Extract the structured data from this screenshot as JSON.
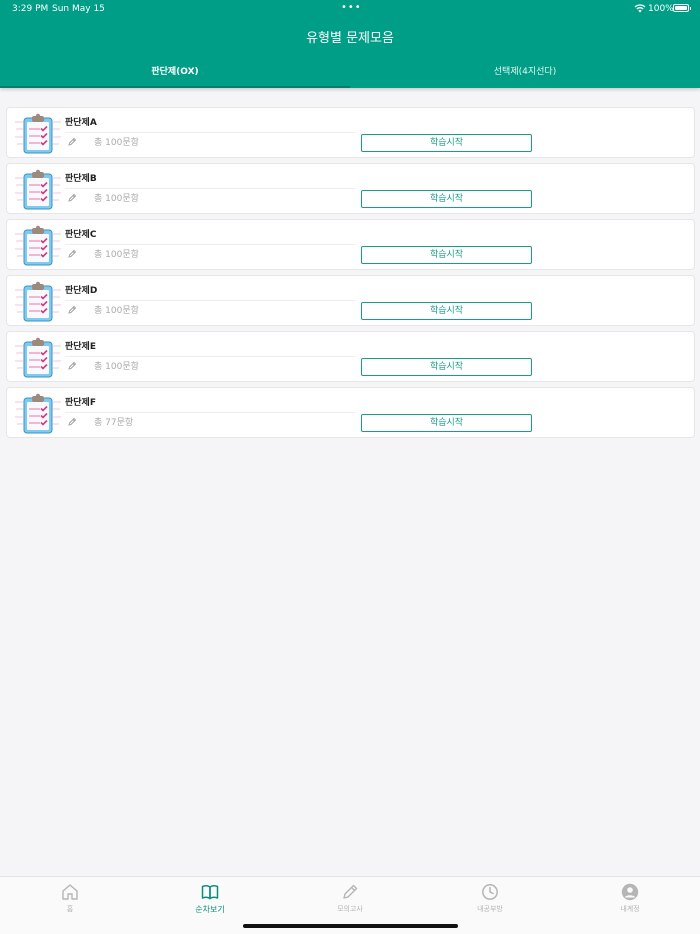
{
  "status_bar": {
    "time": "3:29 PM",
    "date": "Sun May 15",
    "dots": "•••",
    "battery_text": "100%"
  },
  "header": {
    "title": "유형별 문제모음"
  },
  "tabs": [
    {
      "label": "판단제(OX)",
      "active": true
    },
    {
      "label": "선택제(4지선다)",
      "active": false
    }
  ],
  "items": [
    {
      "name": "판단제A",
      "count": "총 100문항",
      "button": "학습시작"
    },
    {
      "name": "판단제B",
      "count": "총 100문항",
      "button": "학습시작"
    },
    {
      "name": "판단제C",
      "count": "총 100문항",
      "button": "학습시작"
    },
    {
      "name": "판단제D",
      "count": "총 100문항",
      "button": "학습시작"
    },
    {
      "name": "판단제E",
      "count": "총 100문항",
      "button": "학습시작"
    },
    {
      "name": "판단제F",
      "count": "총 77문항",
      "button": "학습시작"
    }
  ],
  "bottom_nav": [
    {
      "label": "홈",
      "icon": "home-icon",
      "active": false
    },
    {
      "label": "순차보기",
      "icon": "book-icon",
      "active": true
    },
    {
      "label": "모의고사",
      "icon": "pencil-icon",
      "active": false
    },
    {
      "label": "내공부방",
      "icon": "clock-icon",
      "active": false
    },
    {
      "label": "내계정",
      "icon": "user-icon",
      "active": false
    }
  ],
  "colors": {
    "primary": "#009e86",
    "accent": "#1a9c86"
  }
}
